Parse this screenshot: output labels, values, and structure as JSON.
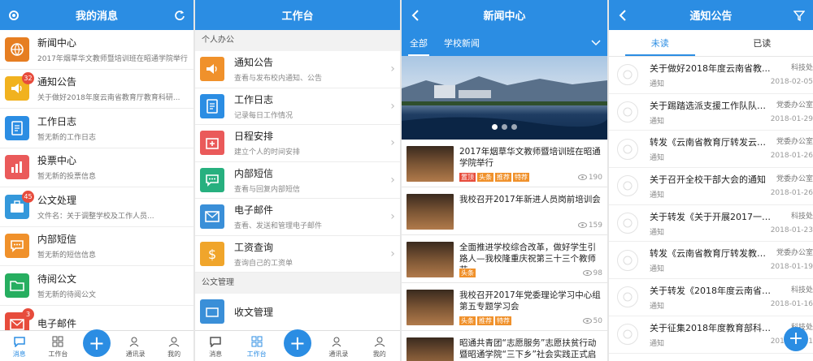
{
  "colors": {
    "primary": "#2b8de3",
    "badge": "#e74c3c"
  },
  "p1": {
    "title": "我的消息",
    "items": [
      {
        "title": "新闻中心",
        "sub": "2017年烟草华文教师暨培训班在昭通学院举行",
        "icon": "globe-icon",
        "color": "#e67e22"
      },
      {
        "title": "通知公告",
        "sub": "关于做好2018年度云南省教育厅教育科研...",
        "icon": "speaker-icon",
        "color": "#f1b21f",
        "badge": "32"
      },
      {
        "title": "工作日志",
        "sub": "暂无新的工作日志",
        "icon": "document-icon",
        "color": "#2b8de3"
      },
      {
        "title": "投票中心",
        "sub": "暂无新的投票信息",
        "icon": "chart-icon",
        "color": "#ea5a5a"
      },
      {
        "title": "公文处理",
        "sub": "文件名：关于调整学校及工作人员...",
        "icon": "briefcase-icon",
        "color": "#3498db",
        "badge": "45"
      },
      {
        "title": "内部短信",
        "sub": "暂无新的短信信息",
        "icon": "chat-icon",
        "color": "#f0912b"
      },
      {
        "title": "待阅公文",
        "sub": "暂无新的待阅公文",
        "icon": "folder-icon",
        "color": "#27ae60"
      },
      {
        "title": "电子邮件",
        "sub": "",
        "icon": "mail-icon",
        "color": "#e74c3c",
        "badge": "3"
      }
    ],
    "tabs": [
      "消息",
      "工作台",
      "",
      "通讯录",
      "我的"
    ]
  },
  "p2": {
    "title": "工作台",
    "section1": "个人办公",
    "items": [
      {
        "title": "通知公告",
        "sub": "查看与发布校内通知、公告",
        "icon": "speaker-icon",
        "color": "#f0912b"
      },
      {
        "title": "工作日志",
        "sub": "记录每日工作情况",
        "icon": "document-icon",
        "color": "#2b8de3"
      },
      {
        "title": "日程安排",
        "sub": "建立个人的时间安排",
        "icon": "calendar-icon",
        "color": "#ea5a5a"
      },
      {
        "title": "内部短信",
        "sub": "查看与回复内部短信",
        "icon": "chat-icon",
        "color": "#27b07f"
      },
      {
        "title": "电子邮件",
        "sub": "查看、发送和管理电子邮件",
        "icon": "mail-icon",
        "color": "#3a8fd8"
      },
      {
        "title": "工资查询",
        "sub": "查询自己的工资单",
        "icon": "dollar-icon",
        "color": "#f0a52b"
      }
    ],
    "section2": "公文管理",
    "item_partial": {
      "title": "收文管理",
      "icon": "inbox-icon",
      "color": "#3a8fd8"
    },
    "tabs": [
      "消息",
      "工作台",
      "",
      "通讯录",
      "我的"
    ]
  },
  "p3": {
    "title": "新闻中心",
    "tabs": [
      "全部",
      "学校新闻"
    ],
    "news": [
      {
        "title": "2017年烟草华文教师暨培训班在昭通学院举行",
        "tags": [
          {
            "t": "置顶",
            "c": "#e74c3c"
          },
          {
            "t": "头条",
            "c": "#f0912b"
          },
          {
            "t": "推荐",
            "c": "#f0912b"
          },
          {
            "t": "特荐",
            "c": "#f0912b"
          }
        ],
        "views": "190"
      },
      {
        "title": "我校召开2017年新进人员岗前培训会",
        "tags": [],
        "views": "159"
      },
      {
        "title": "全面推进学校综合改革，做好学生引路人—我校隆重庆祝第三十三个教师节",
        "tags": [
          {
            "t": "头条",
            "c": "#f0912b"
          }
        ],
        "views": "98"
      },
      {
        "title": "我校召开2017年党委理论学习中心组第五专题学习会",
        "tags": [
          {
            "t": "头条",
            "c": "#f0912b"
          },
          {
            "t": "推荐",
            "c": "#f0912b"
          },
          {
            "t": "特荐",
            "c": "#f0912b"
          }
        ],
        "views": "50"
      },
      {
        "title": "昭通共青团“志愿服务”志愿扶贫行动暨昭通学院“三下乡”社会实践正式启动",
        "tags": [],
        "views": ""
      }
    ]
  },
  "p4": {
    "title": "通知公告",
    "tabs": [
      "未读",
      "已读"
    ],
    "items": [
      {
        "title": "关于做好2018年度云南省教...",
        "dept": "科技处",
        "kind": "通知",
        "date": "2018-02-05"
      },
      {
        "title": "关于踢踏选派支援工作队队伍...",
        "dept": "党委办公室",
        "kind": "通知",
        "date": "2018-01-29"
      },
      {
        "title": "转发《云南省教育厅转发云南...",
        "dept": "党委办公室",
        "kind": "通知",
        "date": "2018-01-26"
      },
      {
        "title": "关于召开全校干部大会的通知",
        "dept": "党委办公室",
        "kind": "通知",
        "date": "2018-01-26"
      },
      {
        "title": "关于转发《关于开展2017一20...",
        "dept": "科技处",
        "kind": "通知",
        "date": "2018-01-23"
      },
      {
        "title": "转发《云南省教育厅转发教育...",
        "dept": "党委办公室",
        "kind": "通知",
        "date": "2018-01-19"
      },
      {
        "title": "关于转发《2018年度云南省哲...",
        "dept": "科技处",
        "kind": "通知",
        "date": "2018-01-16"
      },
      {
        "title": "关于征集2018年度教育部科学...",
        "dept": "科技处",
        "kind": "通知",
        "date": "2018-01-11"
      }
    ]
  }
}
